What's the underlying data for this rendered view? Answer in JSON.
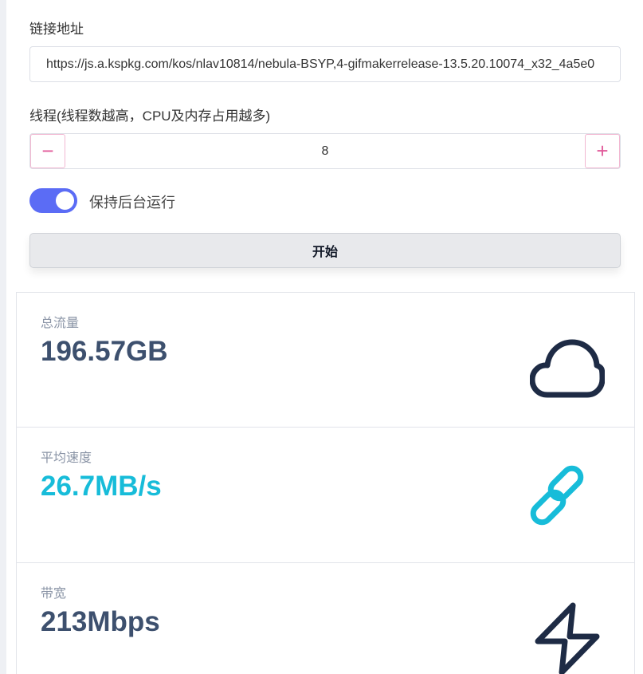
{
  "form": {
    "url_label": "链接地址",
    "url_value": "https://js.a.kspkg.com/kos/nlav10814/nebula-BSYP,4-gifmakerrelease-13.5.20.10074_x32_4a5e0",
    "threads_label": "线程(线程数越高，CPU及内存占用越多)",
    "threads_value": "8",
    "minus_symbol": "−",
    "plus_symbol": "+",
    "keep_background_label": "保持后台运行",
    "keep_background_on": true,
    "start_label": "开始"
  },
  "stats": [
    {
      "title": "总流量",
      "value": "196.57GB",
      "icon": "cloud-icon",
      "color": "#3d506e"
    },
    {
      "title": "平均速度",
      "value": "26.7MB/s",
      "icon": "link-icon",
      "color": "#17bcd9"
    },
    {
      "title": "带宽",
      "value": "213Mbps",
      "icon": "lightning-icon",
      "color": "#3d506e"
    }
  ],
  "colors": {
    "accent": "#5b6cf5",
    "stepper": "#e15a9a",
    "icon_dark": "#1e2b45",
    "icon_cyan": "#17bcd9"
  }
}
